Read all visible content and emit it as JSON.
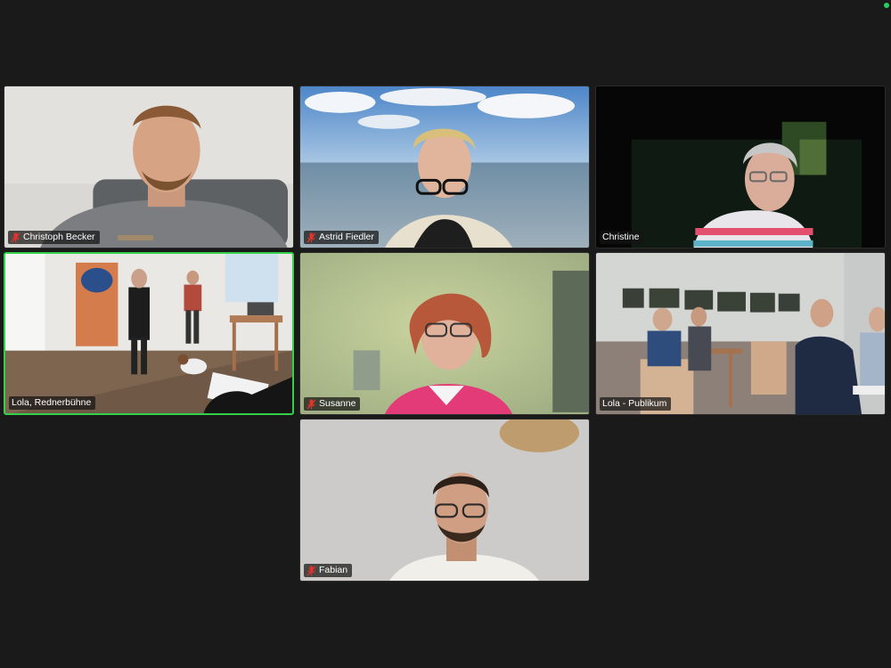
{
  "participants": [
    {
      "name": "Christoph Becker",
      "muted": true
    },
    {
      "name": "Astrid Fiedler",
      "muted": true
    },
    {
      "name": "Christine",
      "muted": false
    },
    {
      "name": "Lola, Rednerbühne",
      "muted": false,
      "active_speaker": true
    },
    {
      "name": "Susanne",
      "muted": true
    },
    {
      "name": "Lola - Publikum",
      "muted": false
    },
    {
      "name": "Fabian",
      "muted": true
    }
  ],
  "colors": {
    "background": "#1a1a1a",
    "active_speaker_border": "#35d04a",
    "muted_icon": "#e5332a",
    "status_dot": "#23d160"
  },
  "icons": {
    "muted": "microphone-muted-icon",
    "status": "connection-status-icon"
  }
}
